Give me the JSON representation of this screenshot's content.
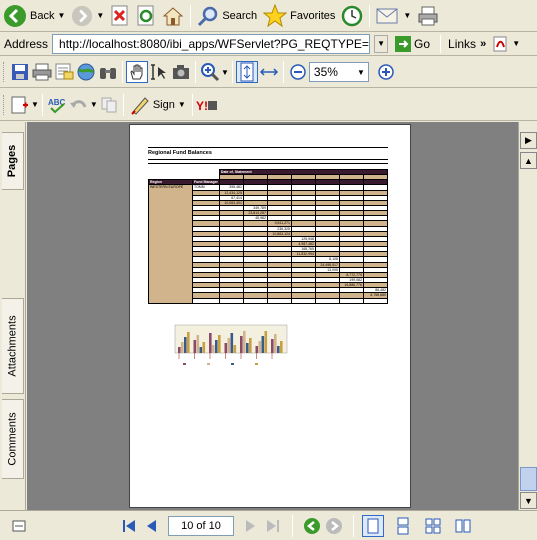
{
  "ie_toolbar": {
    "back": "Back",
    "search": "Search",
    "favorites": "Favorites"
  },
  "address": {
    "label": "Address",
    "url": "http://localhost:8080/ibi_apps/WFServlet?PG_REQTYPE=RE",
    "go": "Go",
    "links": "Links"
  },
  "pdf_toolbar": {
    "zoom_value": "35%",
    "sign_label": "Sign"
  },
  "side_tabs": {
    "pages": "Pages",
    "attachments": "Attachments",
    "comments": "Comments"
  },
  "report": {
    "title": "Regional Fund Balances",
    "header_date": "Date of, Statement",
    "header_region": "Region",
    "header_manager": "Fund Manager",
    "region_name": "WESTERN EUROPE",
    "manager_name": "TOMM",
    "date_cols": [
      "",
      "",
      "",
      "",
      "",
      "",
      ""
    ],
    "cell_values": [
      "395,481",
      "12,434,125",
      "67,414",
      "10,063,401",
      "349,789",
      "23,814,287",
      "45,982",
      "9,811,271",
      "236,325",
      "10,863,124",
      "125,948",
      "4,987,482",
      "168,765",
      "11,832,994",
      "8,108",
      "24,498,917",
      "13,095",
      "8,772,779",
      "199,082",
      "16,886,776",
      "86,482",
      "8,758,680"
    ]
  },
  "status": {
    "page_indicator": "10 of 10"
  },
  "colors": {
    "table_header": "#3a1a2e",
    "table_tan": "#d2b48c",
    "window_bg": "#ece9d8",
    "doc_bg": "#808080"
  }
}
